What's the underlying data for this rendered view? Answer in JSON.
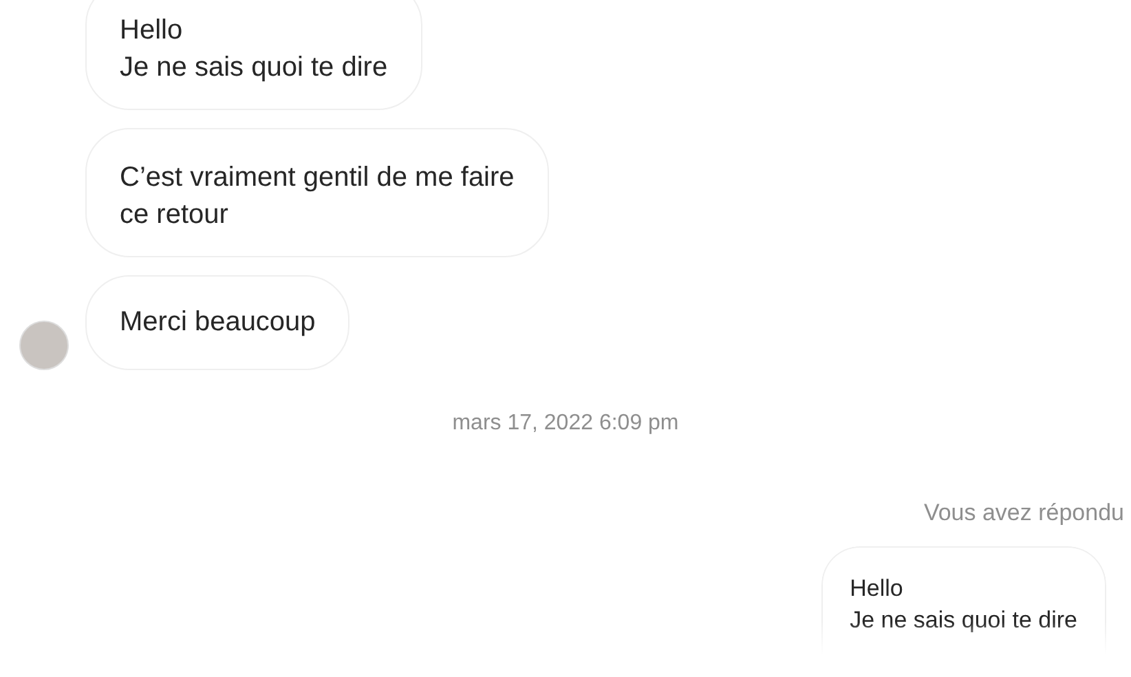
{
  "messages": [
    {
      "lines": [
        "Hello",
        "Je ne sais quoi te dire"
      ]
    },
    {
      "lines": [
        "C’est vraiment gentil de me faire",
        "ce retour"
      ]
    },
    {
      "lines": [
        "Merci beaucoup"
      ]
    }
  ],
  "timestamp": "mars 17, 2022 6:09 pm",
  "reply": {
    "label": "Vous avez répondu",
    "lines": [
      "Hello",
      "Je ne sais quoi te dire"
    ]
  }
}
